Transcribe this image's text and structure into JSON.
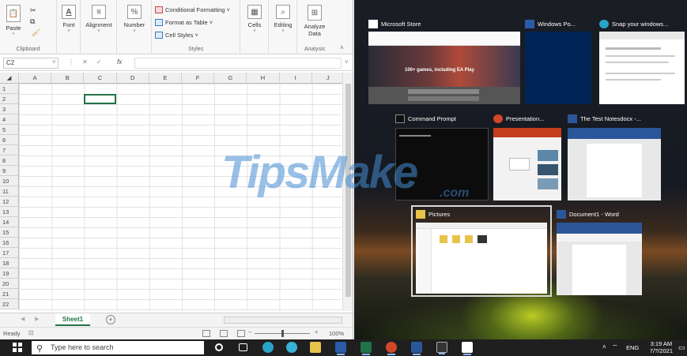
{
  "excel": {
    "ribbon": {
      "clipboard": {
        "paste": "Paste",
        "group": "Clipboard"
      },
      "font": "Font",
      "alignment": "Alignment",
      "number": "Number",
      "styles": {
        "conditional": "Conditional Formatting ˅",
        "format_table": "Format as Table ˅",
        "cell_styles": "Cell Styles ˅",
        "group": "Styles"
      },
      "cells": "Cells",
      "editing": "Editing",
      "analyze": "Analyze Data",
      "analysis_group": "Analysis"
    },
    "namebox": "C2",
    "fx": "fx",
    "columns": [
      "A",
      "B",
      "C",
      "D",
      "E",
      "F",
      "G",
      "H",
      "I",
      "J"
    ],
    "rows": [
      "1",
      "2",
      "3",
      "4",
      "5",
      "6",
      "7",
      "8",
      "9",
      "10",
      "11",
      "12",
      "13",
      "14",
      "15",
      "16",
      "17",
      "18",
      "19",
      "20",
      "21",
      "22"
    ],
    "sheet_tab": "Sheet1",
    "status": "Ready",
    "zoom": "100%"
  },
  "taskview": {
    "windows": [
      {
        "title": "Microsoft Store",
        "icon": "store-icon",
        "banner": "100+ games, including EA Play"
      },
      {
        "title": "Windows Po...",
        "icon": "powershell-icon"
      },
      {
        "title": "Snap your windows...",
        "icon": "edge-icon"
      },
      {
        "title": "Command Prompt",
        "icon": "cmd-icon"
      },
      {
        "title": "Presentation...",
        "icon": "powerpoint-icon"
      },
      {
        "title": "The Test Notesdocx -...",
        "icon": "word-icon"
      },
      {
        "title": "Pictures",
        "icon": "folder-icon"
      },
      {
        "title": "Document1 - Word",
        "icon": "word-icon"
      }
    ],
    "watermark": "TipsMake",
    "watermark_suffix": ".com"
  },
  "taskbar": {
    "search_placeholder": "Type here to search",
    "language": "ENG",
    "time": "3:19 AM",
    "date": "7/?/2021"
  },
  "colors": {
    "excel_green": "#217346",
    "taskbar": "#1f1f1f",
    "watermark": "#468cd2"
  }
}
